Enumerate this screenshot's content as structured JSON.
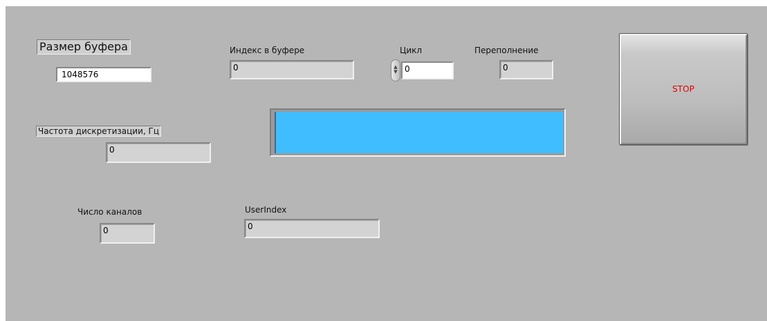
{
  "buffer_size": {
    "label": "Размер буфера",
    "value": "1048576"
  },
  "buffer_index": {
    "label": "Индекс в буфере",
    "value": "0"
  },
  "cycle": {
    "label": "Цикл",
    "value": "0",
    "spinner_up": "▲",
    "spinner_down": "▼"
  },
  "overflow": {
    "label": "Переполнение",
    "value": "0"
  },
  "sample_rate": {
    "label": "Частота дискретизации, Гц",
    "value": "0"
  },
  "channel_count": {
    "label": "Число каналов",
    "value": "0"
  },
  "user_index": {
    "label": "UserIndex",
    "value": "0"
  },
  "progress": {
    "fill_fraction": 1.0,
    "fill_color": "#3fbdff"
  },
  "stop_button": {
    "label": "STOP",
    "text_color": "#e00000"
  },
  "colors": {
    "panel_bg": "#b6b6b6",
    "indicator_bg": "#d3d3d3"
  }
}
